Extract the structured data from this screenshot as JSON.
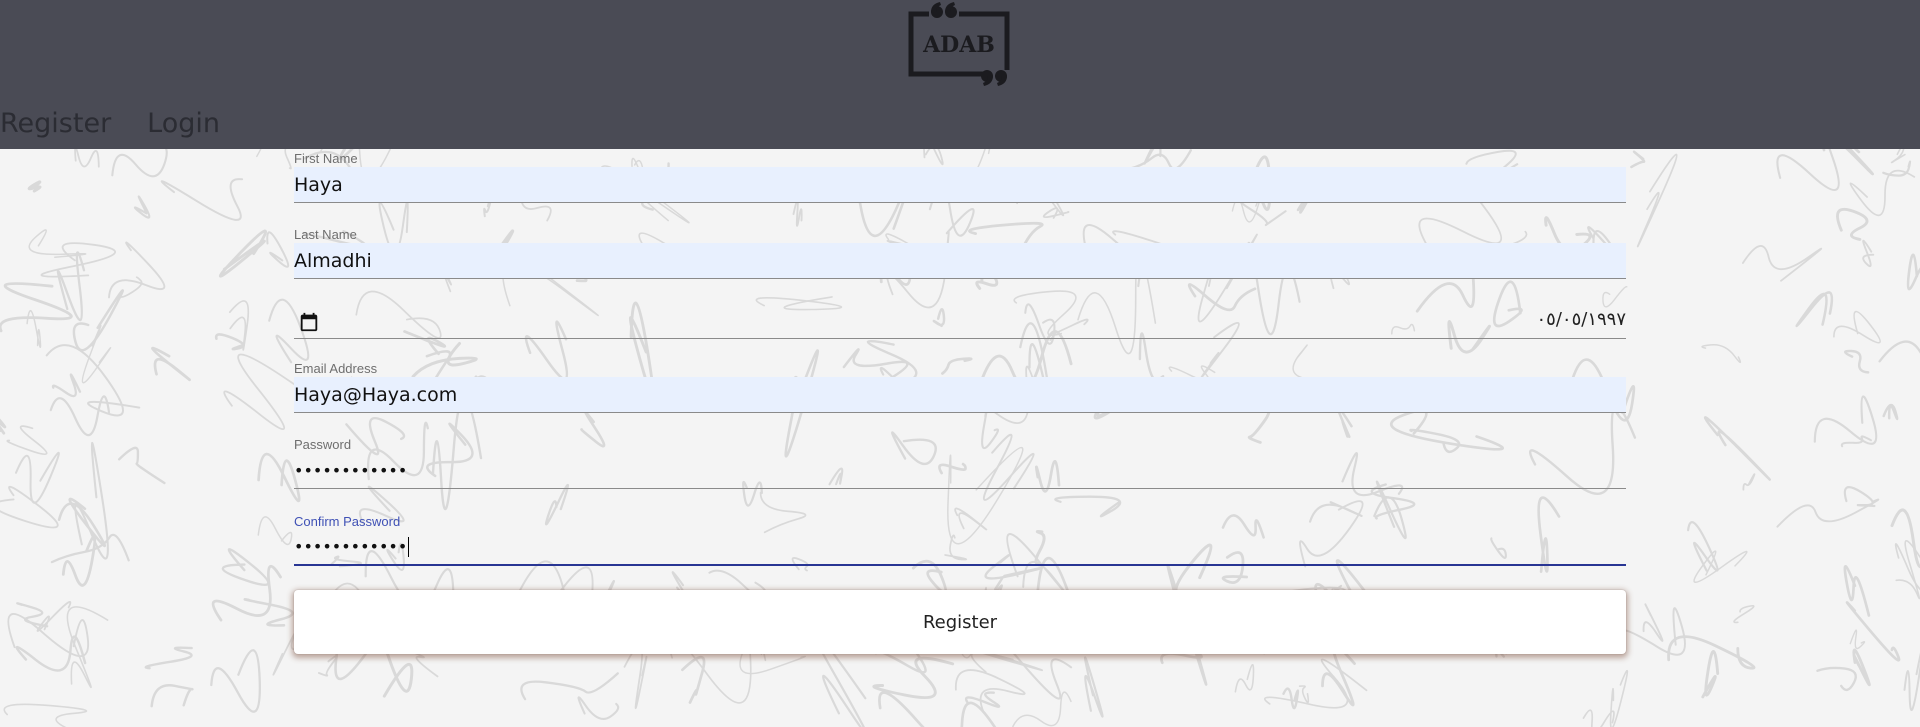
{
  "header": {
    "logo_text": "ADAB",
    "nav": [
      {
        "label": "Register"
      },
      {
        "label": "Login"
      }
    ]
  },
  "form": {
    "first_name": {
      "label": "First Name",
      "value": "Haya"
    },
    "last_name": {
      "label": "Last Name",
      "value": "Almadhi"
    },
    "date_of_birth": {
      "value": "٠٥/٠٥/١٩٩٧",
      "icon": "calendar-icon"
    },
    "email": {
      "label": "Email Address",
      "value": "Haya@Haya.com"
    },
    "password": {
      "label": "Password",
      "value": "••••••••••••"
    },
    "confirm_password": {
      "label": "Confirm Password",
      "value": "••••••••••••"
    },
    "submit_label": "Register"
  },
  "colors": {
    "header_bg": "#4a4b55",
    "autofill_bg": "#e8f0fe",
    "focus_accent": "#3f51b5"
  }
}
